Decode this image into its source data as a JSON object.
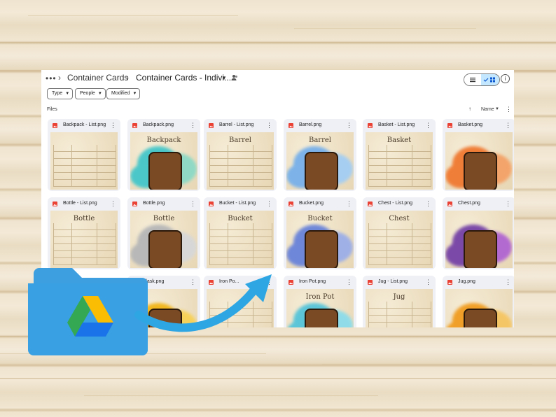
{
  "breadcrumb": {
    "more": "•••",
    "parent": "Container Cards",
    "current": "Container Cards - Indivi..."
  },
  "filters": [
    "Type",
    "People",
    "Modified"
  ],
  "files_label": "Files",
  "sort": {
    "label": "Name"
  },
  "cards": [
    {
      "title": "Backpack - List.png",
      "kind": "list",
      "label": ""
    },
    {
      "title": "Backpack.png",
      "kind": "art",
      "label": "Backpack"
    },
    {
      "title": "Barrel - List.png",
      "kind": "list",
      "label": "Barrel"
    },
    {
      "title": "Barrel.png",
      "kind": "art",
      "label": "Barrel"
    },
    {
      "title": "Basket - List.png",
      "kind": "list",
      "label": "Basket"
    },
    {
      "title": "Basket.png",
      "kind": "art",
      "label": ""
    },
    {
      "title": "Bottle - List.png",
      "kind": "list",
      "label": "Bottle"
    },
    {
      "title": "Bottle.png",
      "kind": "art",
      "label": "Bottle"
    },
    {
      "title": "Bucket - List.png",
      "kind": "list",
      "label": "Bucket"
    },
    {
      "title": "Bucket.png",
      "kind": "art",
      "label": "Bucket"
    },
    {
      "title": "Chest - List.png",
      "kind": "list",
      "label": "Chest"
    },
    {
      "title": "Chest.png",
      "kind": "art",
      "label": ""
    },
    {
      "title": "",
      "kind": "hidden",
      "label": ""
    },
    {
      "title": "Flask.png",
      "kind": "art",
      "label": ""
    },
    {
      "title": "Iron Po...",
      "kind": "list",
      "label": ""
    },
    {
      "title": "Iron Pot.png",
      "kind": "art",
      "label": "Iron Pot"
    },
    {
      "title": "Jug - List.png",
      "kind": "list",
      "label": "Jug"
    },
    {
      "title": "Jug.png",
      "kind": "art",
      "label": ""
    }
  ],
  "icons": {
    "view_list": "list-view-icon",
    "view_grid": "grid-view-icon",
    "info": "info-icon",
    "share": "shared-people-icon",
    "drive": "google-drive-folder-icon"
  },
  "colors": {
    "accent": "#c2e7ff",
    "image_icon": "#ea4335",
    "folder": "#3d9fe0",
    "arrow": "#2fa6e4"
  }
}
